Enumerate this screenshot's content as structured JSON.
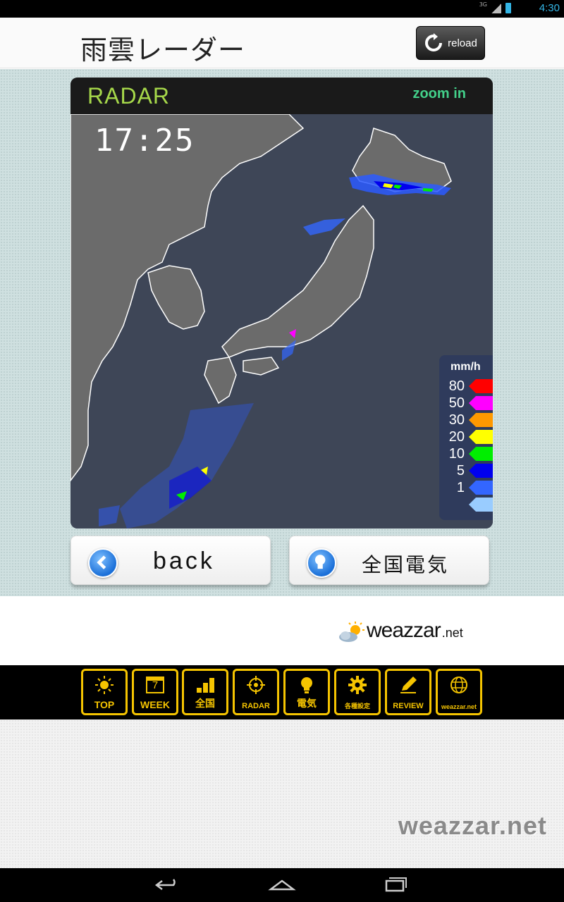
{
  "status_bar": {
    "network": "3G",
    "time": "4:30"
  },
  "header": {
    "title": "雨雲レーダー",
    "reload_label": "reload"
  },
  "radar": {
    "label": "RADAR",
    "zoom_label": "zoom in",
    "time": "17:25",
    "legend": {
      "unit": "mm/h",
      "levels": [
        {
          "value": "80",
          "color": "#ff0000"
        },
        {
          "value": "50",
          "color": "#ff00ff"
        },
        {
          "value": "30",
          "color": "#ff9900"
        },
        {
          "value": "20",
          "color": "#ffff00"
        },
        {
          "value": "10",
          "color": "#00ee00"
        },
        {
          "value": "5",
          "color": "#0000ee"
        },
        {
          "value": "1",
          "color": "#3366ff"
        },
        {
          "value": "",
          "color": "#99ccff"
        }
      ]
    }
  },
  "buttons": {
    "back": "back",
    "national_weather": "全国電気"
  },
  "brand": {
    "main": "weazzar",
    "sub": ".net"
  },
  "tabs": [
    {
      "label": "TOP",
      "icon": "sun-icon"
    },
    {
      "label": "WEEK",
      "icon": "calendar-icon",
      "number": "7"
    },
    {
      "label": "全国",
      "icon": "stairs-icon"
    },
    {
      "label": "RADAR",
      "icon": "crosshair-icon"
    },
    {
      "label": "電気",
      "icon": "bulb-icon"
    },
    {
      "label": "各種設定",
      "icon": "gear-icon"
    },
    {
      "label": "REVIEW",
      "icon": "pencil-icon"
    },
    {
      "label": "weazzar.net",
      "icon": "globe-icon"
    }
  ],
  "watermark": "weazzar.net",
  "colors": {
    "accent": "#f5c400",
    "radar_green": "#a6d84a",
    "zoom_green": "#43d08a",
    "status_blue": "#33b5e5"
  }
}
